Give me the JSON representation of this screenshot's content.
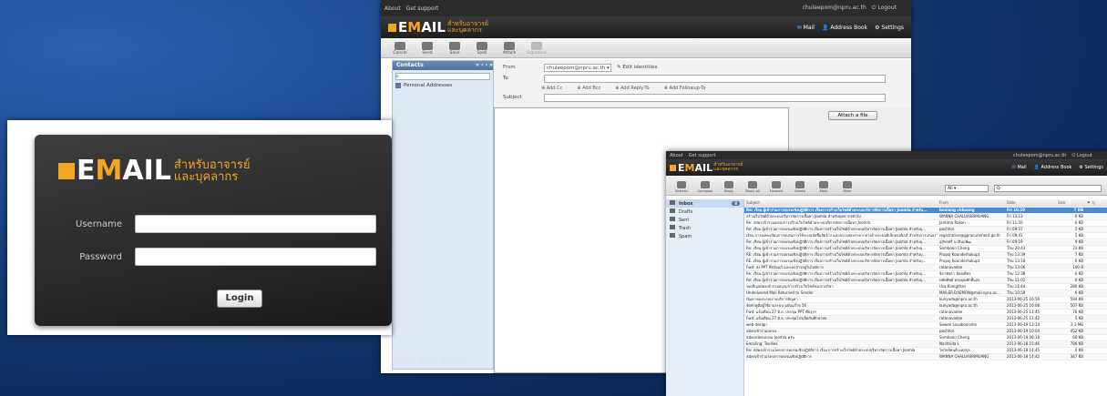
{
  "compose": {
    "topbar": {
      "links": [
        "About",
        "Get support"
      ],
      "user": "chuleepom@npru.ac.th",
      "logout": "Logout"
    },
    "logo": {
      "brand_e": "E",
      "brand_m": "M",
      "brand_rest": "AIL",
      "thai1": "สำหรับอาจารย์",
      "thai2": "และบุคลากร"
    },
    "nav": {
      "mail": "Mail",
      "address_book": "Address Book",
      "settings": "Settings"
    },
    "toolbar": [
      "Cancel",
      "Send",
      "Save",
      "Spell",
      "Attach",
      "Signature"
    ],
    "contacts": {
      "title": "Contacts",
      "personal": "Personal Addresses",
      "footer": [
        "Re",
        "Ge",
        "Bon"
      ]
    },
    "form": {
      "from_label": "From",
      "from_value": "chuleepom@npru.ac.th",
      "edit_identities": "Edit identities",
      "to_label": "To",
      "subject_label": "Subject",
      "add": [
        "Add Cc",
        "Add Bcc",
        "Add Reply-To",
        "Add Followup-To"
      ]
    },
    "attach_button": "Attach a file"
  },
  "login": {
    "logo": {
      "brand_e": "E",
      "brand_m": "M",
      "brand_rest": "AIL",
      "thai1": "สำหรับอาจารย์",
      "thai2": "และบุคลากร"
    },
    "username_label": "Username",
    "password_label": "Password",
    "login_button": "Login"
  },
  "inbox": {
    "topbar": {
      "links": [
        "About",
        "Get support"
      ],
      "user": "chuleepom@npru.ac.th",
      "logout": "Logout"
    },
    "logo": {
      "brand_e": "E",
      "brand_m": "M",
      "brand_rest": "AIL",
      "thai1": "สำหรับอาจารย์",
      "thai2": "และบุคลากร"
    },
    "nav": {
      "mail": "Mail",
      "address_book": "Address Book",
      "settings": "Settings"
    },
    "toolbar": [
      "Refresh",
      "Compose",
      "Reply",
      "Reply all",
      "Forward",
      "Delete",
      "Mark",
      "More"
    ],
    "filter": "All",
    "search_placeholder": "Q-",
    "folders": [
      {
        "name": "Inbox",
        "count": "8"
      },
      {
        "name": "Drafts",
        "count": ""
      },
      {
        "name": "Sent",
        "count": ""
      },
      {
        "name": "Trash",
        "count": ""
      },
      {
        "name": "Spam",
        "count": ""
      }
    ],
    "columns": [
      "Subject",
      "From",
      "Date",
      "Size"
    ],
    "messages": [
      {
        "s": "Re: เรียน ผู้เข้าร่วมการอบรมเชิงปฏิบัติการ เรื่องการสร้างเว็บไซต์ด้วยระบบบริหารจัดการเนื้อหา Joomla สำหรับ...",
        "f": "boxiang chhuong",
        "d": "Fri 10:10",
        "z": "7 KB"
      },
      {
        "s": "สร้างเว็บไซต์ด้วยระบบบริหารจัดการเนื้อหา Joomla สำหรับบุคลากรทั่วไป",
        "f": "WANNA CHALUASRIMUANG",
        "d": "Fri 13:13",
        "z": "6 KB"
      },
      {
        "s": "Re: สมัครเข้าร่วมอบรมการสร้างเว็บไซต์ด้วยระบบบริหารจัดการเนื้อหา Joomla",
        "f": "Jantima Rakon",
        "d": "Fri 11:50",
        "z": "6 KB"
      },
      {
        "s": "Re: เรียน ผู้เข้าร่วมการอบรมเชิงปฏิบัติการ เรื่องการสร้างเว็บไซต์ด้วยระบบบริหารจัดการเนื้อหา Joomla สำหรับบุ...",
        "f": "pachton",
        "d": "Fri 09:57",
        "z": "5 KB"
      },
      {
        "s": "เรียน การลงทะเบียนการอบรมการใช้ระบบจัดซื้อจัดจ้าง และตรวจสอบราคากลางด้วยระบบอิเล็กทรอนิกส์ สำหรับการเสนอราคาผู้ซื้อ...",
        "f": "registration@gprocurement.go.th",
        "d": "Fri 09:41",
        "z": "5 KB"
      },
      {
        "s": "Re: เรียน ผู้เข้าร่วมการอบรมเชิงปฏิบัติการ เรื่องการสร้างเว็บไซต์ด้วยระบบบริหารจัดการเนื้อหา Joomla สำหรับบุ...",
        "f": "สุภัทรศรี นวลินฤพัฒ",
        "d": "Fri 09:19",
        "z": "9 KB"
      },
      {
        "s": "Re: เรียน ผู้เข้าร่วมการอบรมเชิงปฏิบัติการ เรื่องการสร้างเว็บไซต์ด้วยระบบบริหารจัดการเนื้อหา Joomla สำหรับบุ...",
        "f": "Somboon Cheng",
        "d": "Thu 20:43",
        "z": "23 KB"
      },
      {
        "s": "RE: เรียน ผู้เข้าร่วมการอบรมเชิงปฏิบัติการ เรื่องการสร้างเว็บไซต์ด้วยระบบบริหารจัดการเนื้อหา Joomla สำหรับบุ...",
        "f": "Prapoj Kounderhakupt",
        "d": "Thu 13:39",
        "z": "7 KB"
      },
      {
        "s": "RE: เรียน ผู้เข้าร่วมการอบรมเชิงปฏิบัติการ เรื่องการสร้างเว็บไซต์ด้วยระบบบริหารจัดการเนื้อหา Joomla สำหรับบุ...",
        "f": "Prapoj Kounderhakupt",
        "d": "Thu 13:18",
        "z": "6 KB"
      },
      {
        "s": "Fwd: ส่ง PPT ที่ปรับแก้ และเอกสารอยู่ในไฟล์การ",
        "f": "ratanavadee",
        "d": "Thu 13:06",
        "z": "100 B"
      },
      {
        "s": "Re: เรียน ผู้เข้าร่วมการอบรมเชิงปฏิบัติการ เรื่องการสร้างเว็บไซต์ด้วยระบบบริหารจัดการเนื้อหา Joomla สำหรับบุ...",
        "f": "จิดาพัชรา ช้อยเพ็ชร",
        "d": "Thu 12:38",
        "z": "6 KB"
      },
      {
        "s": "Re: เรียน ผู้เข้าร่วมการอบรมเชิงปฏิบัติการ เรื่องการสร้างเว็บไซต์ด้วยระบบบริหารจัดการเนื้อหา Joomla สำหรับบุ...",
        "f": "หทัยทิพย์ ทรงคุณศักดิ์แสง",
        "d": "Thu 11:01",
        "z": "6 KB"
      },
      {
        "s": "ขอเชิญสมัครเข้าร่วมอบรมการสร้างเว็บไซต์ของรายวิชา",
        "f": "Usa Klangthan",
        "d": "Thu 11:44",
        "z": "280 KB"
      },
      {
        "s": "Undelivered Mail Returned to Sender",
        "f": "MAILER-DAEMON@mail.npru.ac...",
        "d": "Thu 10:59",
        "z": "6 KB"
      },
      {
        "s": "ปัญหาของระบบงานบริการปัญหา",
        "f": "kunyada@npru.ac.th",
        "d": "2013-06-25 16:56",
        "z": "594 KB"
      },
      {
        "s": "จัดทำคู่มือผู้ใช้งานระบบ ฉบับแก้ไข 56",
        "f": "kunyada@npru.ac.th",
        "d": "2013-06-25 16:08",
        "z": "507 KB"
      },
      {
        "s": "Fwd: แจ้งเตือน 27 มิ.ย. ประชุม PPT ที่ปรุงฯ",
        "f": "ratanavadee",
        "d": "2013-06-25 11:45",
        "z": "76 KB"
      },
      {
        "s": "Fwd: แจ้งเตือน 27 มิ.ย. ประชุมโปรเจ็คกับศึกษาต่อ",
        "f": "ratanavadee",
        "d": "2013-06-25 11:42",
        "z": "5 KB"
      },
      {
        "s": "web design",
        "f": "Sewee Lovaboonsho",
        "d": "2013-06-19 13:14",
        "z": "2.3 MB"
      },
      {
        "s": "สมัครเข้าร่วมอบรม",
        "f": "pachton",
        "d": "2013-06-19 10:04",
        "z": "452 KB"
      },
      {
        "s": "สมัครสมัครอบรม Joomla ครับ",
        "f": "Somboon Cheng",
        "d": "2013-06-19 08:18",
        "z": "60 KB"
      },
      {
        "s": "Emailing: Toellies",
        "f": "Nanthida L",
        "d": "2013-06-18 15:46",
        "z": "786 KB"
      },
      {
        "s": "Re: สมัครเข้าร่วมโครงการอบรมเชิงปฏิบัติการ เรื่อง การสร้างเว็บไซต์ด้วยระบบบริหารจัดการเนื้อหา Joomla",
        "f": "ไหวัลย์คนดี มหสกุล",
        "d": "2013-06-18 14:45",
        "z": "6 KB"
      },
      {
        "s": "สมัครเข้าร่วมโครงการอบรมเชิงปฏิบัติการ",
        "f": "WANNA CHALUASRIMUANG",
        "d": "2013-06-18 14:42",
        "z": "347 KB"
      }
    ]
  }
}
